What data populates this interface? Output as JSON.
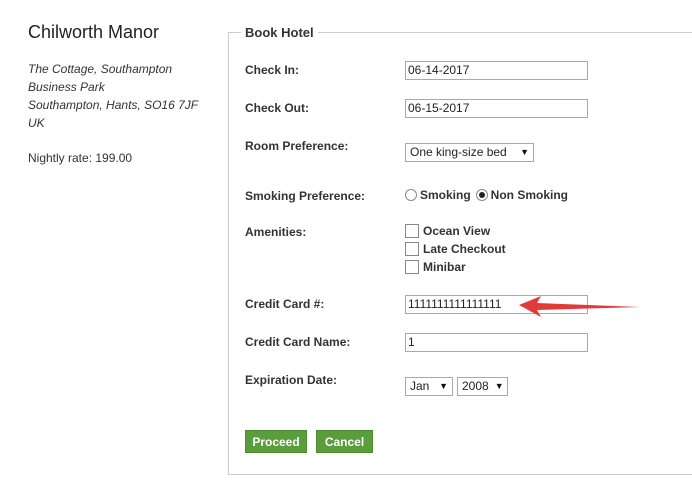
{
  "hotel": {
    "name": "Chilworth Manor",
    "address_lines": [
      "The Cottage, Southampton",
      "Business Park",
      "Southampton, Hants, SO16 7JF",
      "UK"
    ],
    "nightly_rate": "Nightly rate: 199.00"
  },
  "form": {
    "legend": "Book Hotel",
    "check_in": {
      "label": "Check In:",
      "value": "06-14-2017"
    },
    "check_out": {
      "label": "Check Out:",
      "value": "06-15-2017"
    },
    "room_preference": {
      "label": "Room Preference:",
      "selected": "One king-size bed"
    },
    "smoking_preference": {
      "label": "Smoking Preference:",
      "options": [
        "Smoking",
        "Non Smoking"
      ],
      "selected": "Non Smoking"
    },
    "amenities": {
      "label": "Amenities:",
      "options": [
        "Ocean View",
        "Late Checkout",
        "Minibar"
      ]
    },
    "credit_card": {
      "label": "Credit Card #:",
      "value": "1111111111111111"
    },
    "credit_card_name": {
      "label": "Credit Card Name:",
      "value": "1"
    },
    "expiration": {
      "label": "Expiration Date:",
      "month": "Jan",
      "year": "2008"
    },
    "proceed_label": "Proceed",
    "cancel_label": "Cancel"
  },
  "colors": {
    "button_green": "#5a9e3c",
    "annotation_red": "#e03a3a"
  },
  "icons": {
    "dropdown": "triangle-down-icon",
    "annotation": "red-arrow-icon"
  }
}
